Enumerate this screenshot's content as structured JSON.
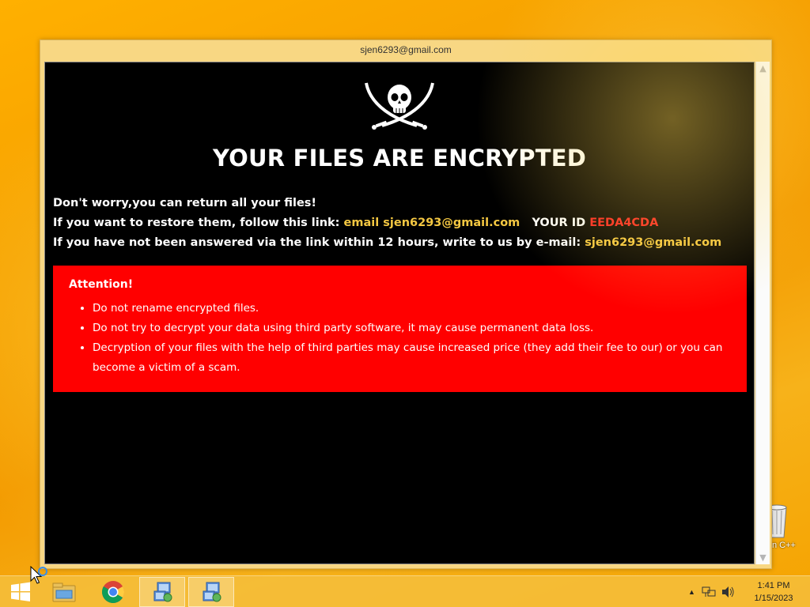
{
  "window": {
    "title": "sjen6293@gmail.com"
  },
  "note": {
    "headline": "YOUR FILES ARE ENCRYPTED",
    "line1": "Don't worry,you can return all your files!",
    "line2_prefix": "If you want to restore them, follow this link:",
    "line2_link": "email sjen6293@gmail.com",
    "line2_id_label": "YOUR ID",
    "line2_id_value": "EEDA4CDA",
    "line3_prefix": "If you have not been answered via the link within 12 hours, write to us by e-mail:",
    "line3_email": "sjen6293@gmail.com",
    "attention": {
      "title": "Attention!",
      "items": [
        "Do not rename encrypted files.",
        "Do not try to decrypt your data using third party software, it may cause permanent data loss.",
        "Decryption of your files with the help of third parties may cause increased price (they add their fee to our) or you can become a victim of a scam."
      ]
    }
  },
  "desktop": {
    "recycle_bin_label": "n C++"
  },
  "taskbar": {
    "items": [
      "start-button",
      "file-explorer",
      "chrome",
      "app-1",
      "app-2"
    ],
    "clock_time": "1:41 PM",
    "clock_date": "1/15/2023"
  },
  "colors": {
    "accent_yellow": "#f5c842",
    "id_red": "#ff2222",
    "attention_bg": "#ff0000",
    "note_bg": "#000000"
  }
}
